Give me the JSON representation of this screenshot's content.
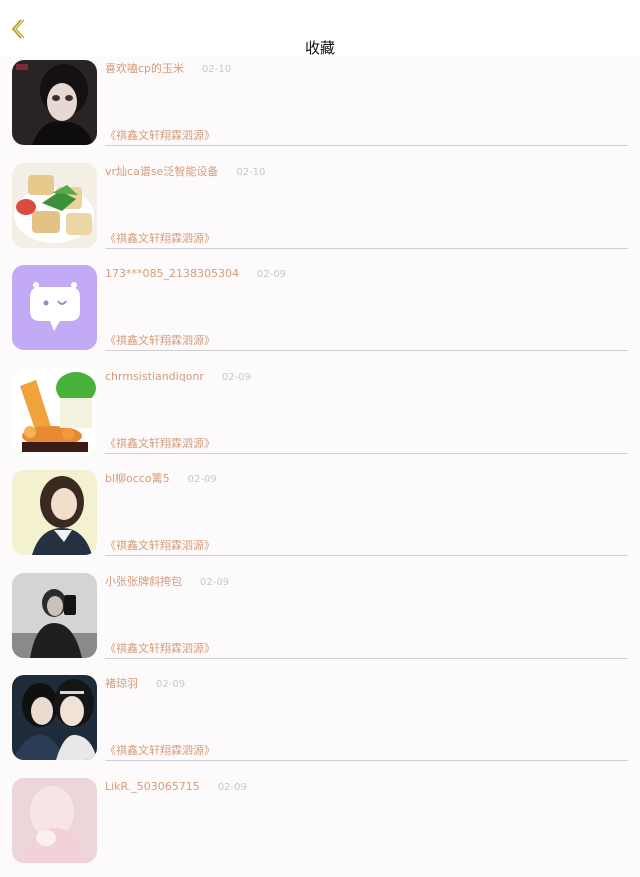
{
  "header": {
    "title": "收藏",
    "back_icon": "chevron-left-icon",
    "back_icon_color": "#b8a02a"
  },
  "items": [
    {
      "name": "喜欢嗑cp的玉米",
      "date": "02-10",
      "book": "《祺鑫文轩翔霖泗源》",
      "avatar": "photo-dark-portrait"
    },
    {
      "name": "vr灿ca谱se泛智能设备",
      "date": "02-10",
      "book": "《祺鑫文轩翔霖泗源》",
      "avatar": "photo-food"
    },
    {
      "name": "173***085_2138305304",
      "date": "02-09",
      "book": "《祺鑫文轩翔霖泗源》",
      "avatar": "default-chat-bubble-icon"
    },
    {
      "name": "chrmsistiandiqonr",
      "date": "02-09",
      "book": "《祺鑫文轩翔霖泗源》",
      "avatar": "photo-figurines"
    },
    {
      "name": "bl柳occo篱5",
      "date": "02-09",
      "book": "《祺鑫文轩翔霖泗源》",
      "avatar": "photo-girl-portrait"
    },
    {
      "name": "小张张牌斜挎包",
      "date": "02-09",
      "book": "《祺鑫文轩翔霖泗源》",
      "avatar": "photo-mirror-selfie"
    },
    {
      "name": "褚琼羽",
      "date": "02-09",
      "book": "《祺鑫文轩翔霖泗源》",
      "avatar": "photo-costume-drama"
    },
    {
      "name": "LikR._503065715",
      "date": "02-09",
      "book": "",
      "avatar": "photo-pink-portrait"
    }
  ],
  "colors": {
    "accent": "#d69c7a",
    "date": "#c8c8c8",
    "divider": "#cfcfcf",
    "default_avatar_bg": "#c3aaf5"
  }
}
